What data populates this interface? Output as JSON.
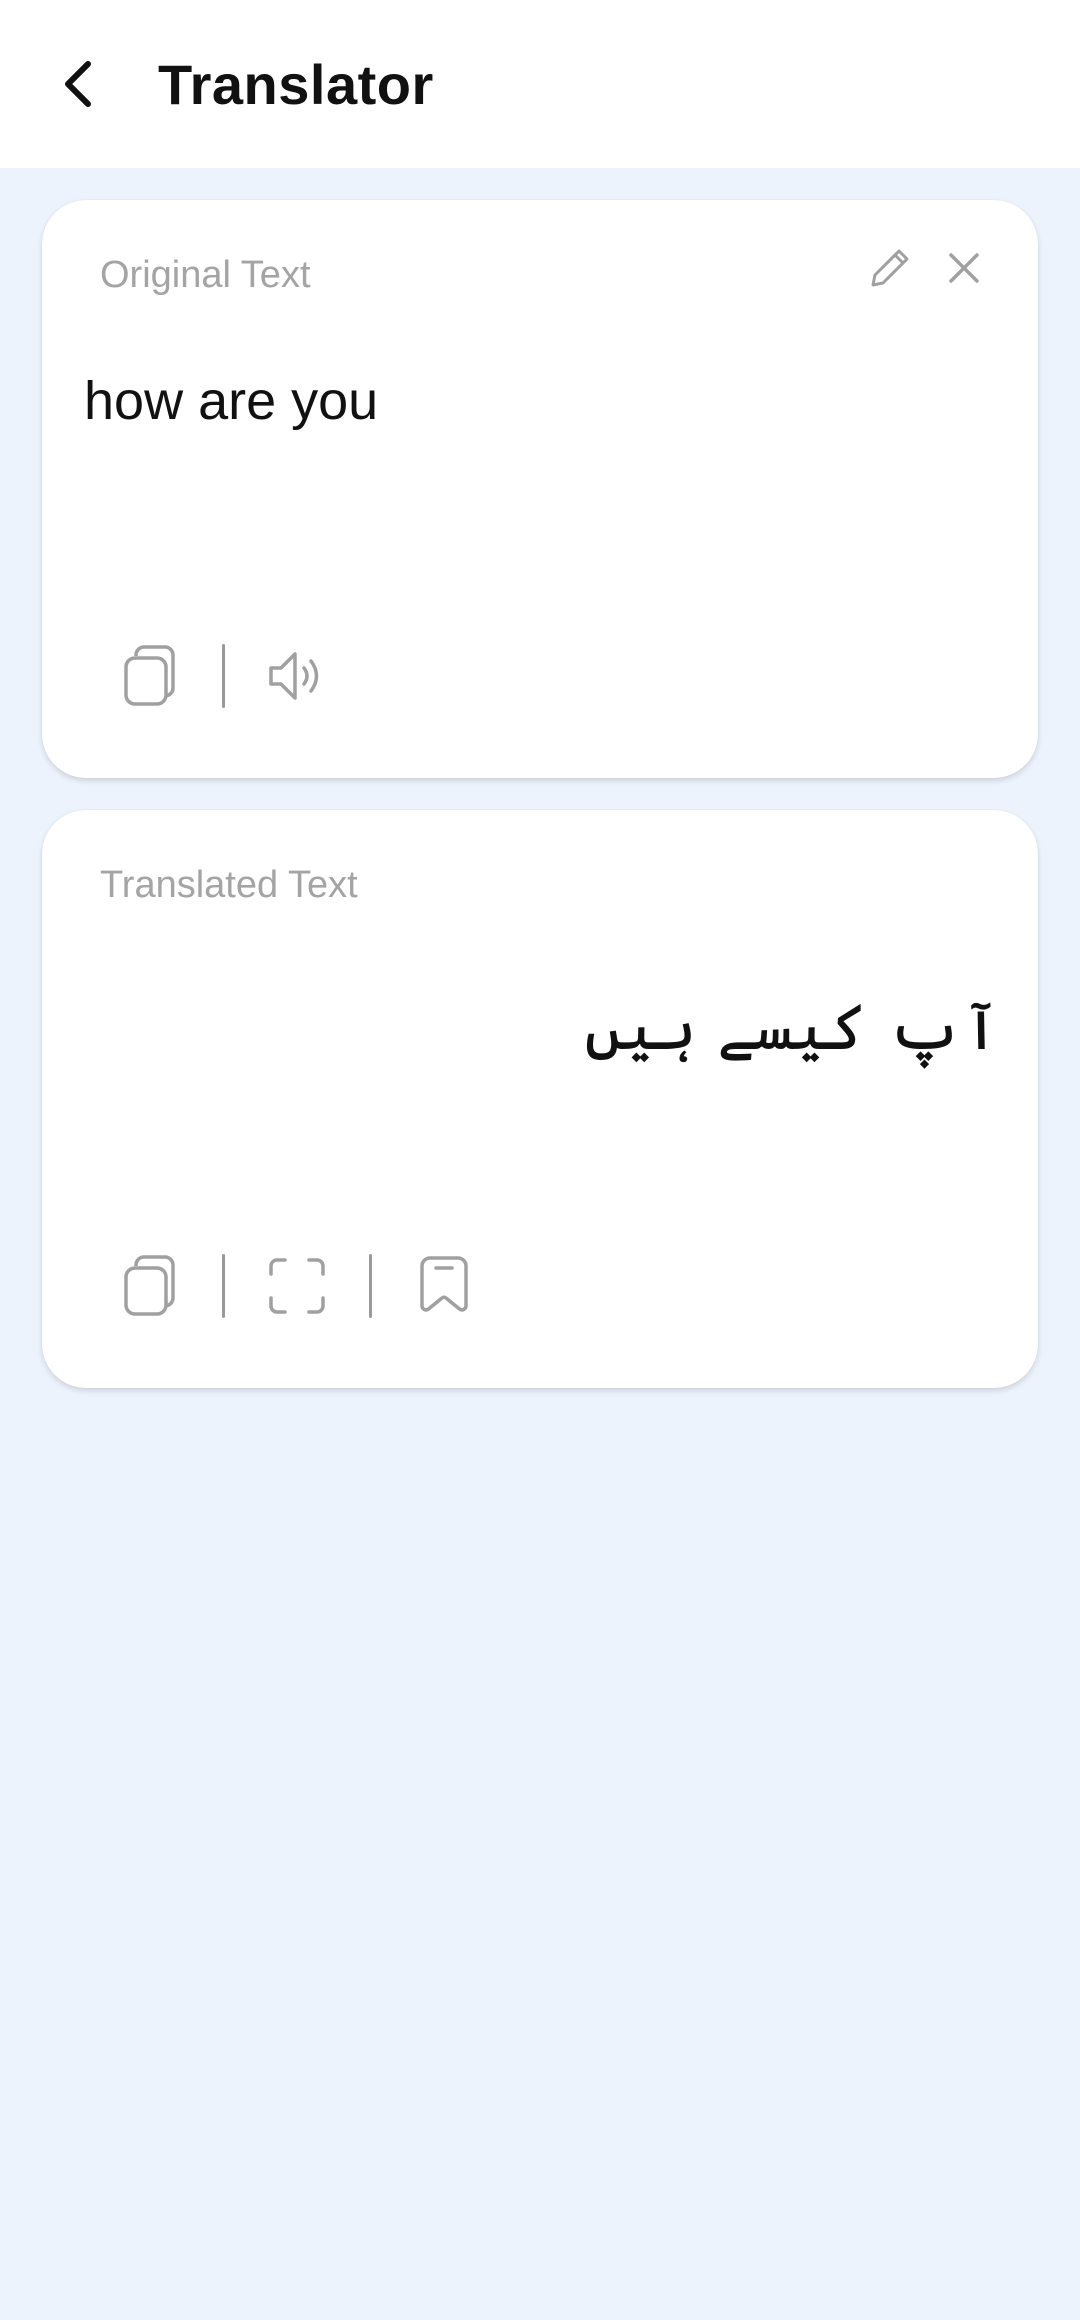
{
  "header": {
    "title": "Translator"
  },
  "original_card": {
    "label": "Original Text",
    "text": "how are you"
  },
  "translated_card": {
    "label": "Translated Text",
    "text": "آپ کیسے ہیں"
  },
  "icons": {
    "back": "back-arrow-icon",
    "edit": "pencil-icon",
    "clear": "close-icon",
    "copy": "copy-icon",
    "speak": "speaker-icon",
    "fullscreen": "fullscreen-icon",
    "bookmark": "bookmark-icon"
  },
  "colors": {
    "background": "#edf3fd",
    "card": "#ffffff",
    "label": "#a4a4a4",
    "text": "#111111",
    "icon": "#a0a0a0"
  }
}
